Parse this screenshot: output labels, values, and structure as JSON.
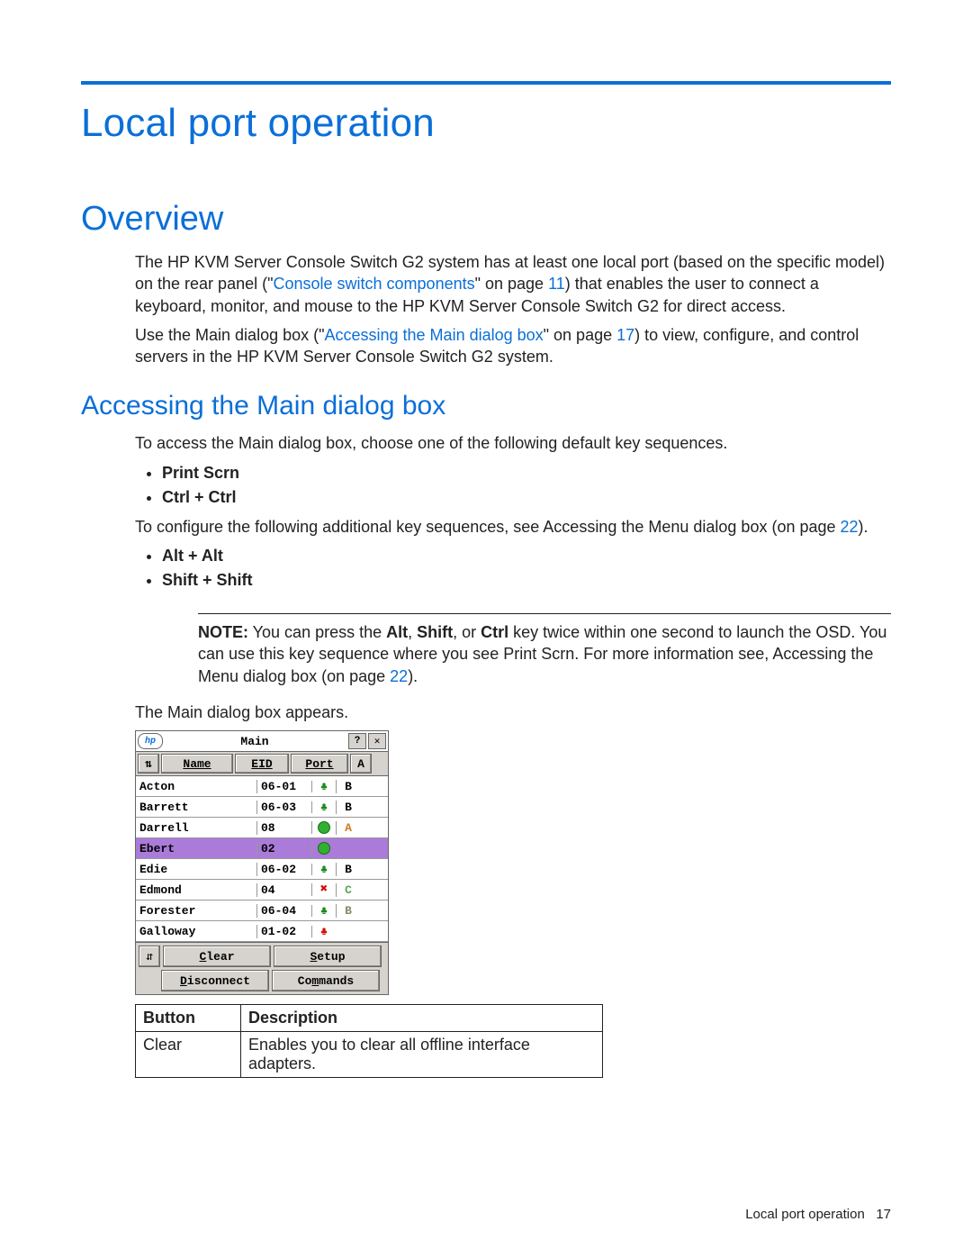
{
  "chapter_title": "Local port operation",
  "section_title": "Overview",
  "para1_a": "The HP KVM Server Console Switch G2 system has at least one local port (based on the specific model) on the rear panel (\"",
  "xref1": "Console switch components",
  "para1_b": "\" on page ",
  "pageref1": "11",
  "para1_c": ") that enables the user to connect a keyboard, monitor, and mouse to the HP KVM Server Console Switch G2 for direct access.",
  "para2_a": "Use the Main dialog box (\"",
  "xref2": "Accessing the Main dialog box",
  "para2_b": "\" on page ",
  "pageref2": "17",
  "para2_c": ") to view, configure, and control servers in the HP KVM Server Console Switch G2 system.",
  "subsection_title": "Accessing the Main dialog box",
  "para3": "To access the Main dialog box, choose one of the following default key sequences.",
  "bullets1": {
    "a": "Print Scrn",
    "b": "Ctrl + Ctrl"
  },
  "para4_a": "To configure the following additional key sequences, see Accessing the Menu dialog box (on page ",
  "pageref3": "22",
  "para4_b": ").",
  "bullets2": {
    "a": "Alt + Alt",
    "b": "Shift + Shift"
  },
  "note_label": "NOTE:",
  "note_a": "  You can press the ",
  "note_alt": "Alt",
  "note_sep1": ", ",
  "note_shift": "Shift",
  "note_sep2": ", or ",
  "note_ctrl": "Ctrl",
  "note_b": " key twice within one second to launch the OSD. You can use this key sequence where you see Print Scrn. For more information see, Accessing the Menu dialog box (on page ",
  "pageref4": "22",
  "note_c": ").",
  "para5": "The Main dialog box appears.",
  "dialog": {
    "title": "Main",
    "help_icon": "?",
    "close_icon": "✕",
    "headers": {
      "sort": "⇅",
      "name": "Name",
      "eid": "EID",
      "port": "Port",
      "a": "A"
    },
    "rows": [
      {
        "name": "Acton",
        "port": "06-01",
        "status": "tree-green",
        "b": "B",
        "bcolor": "#000",
        "selected": false
      },
      {
        "name": "Barrett",
        "port": "06-03",
        "status": "tree-green",
        "b": "B",
        "bcolor": "#000",
        "selected": false
      },
      {
        "name": "Darrell",
        "port": "08",
        "status": "circle",
        "b": "A",
        "bcolor": "#d07a20",
        "selected": false
      },
      {
        "name": "Ebert",
        "port": "02",
        "status": "circle",
        "b": "",
        "bcolor": "#000",
        "selected": true
      },
      {
        "name": "Edie",
        "port": "06-02",
        "status": "tree-green",
        "b": "B",
        "bcolor": "#000",
        "selected": false
      },
      {
        "name": "Edmond",
        "port": "04",
        "status": "x-red",
        "b": "C",
        "bcolor": "#5aa85a",
        "selected": false
      },
      {
        "name": "Forester",
        "port": "06-04",
        "status": "tree-green",
        "b": "B",
        "bcolor": "#8a8a6a",
        "selected": false
      },
      {
        "name": "Galloway",
        "port": "01-02",
        "status": "tree-red",
        "b": "",
        "bcolor": "#000",
        "selected": false
      }
    ],
    "footer": {
      "sort": "⇵",
      "clear_u": "C",
      "clear_r": "lear",
      "setup_u": "S",
      "setup_r": "etup",
      "disconnect_u": "D",
      "disconnect_r": "isconnect",
      "commands_pre": "Co",
      "commands_u": "m",
      "commands_r": "mands"
    }
  },
  "table": {
    "h1": "Button",
    "h2": "Description",
    "r1c1": "Clear",
    "r1c2": "Enables you to clear all offline interface adapters."
  },
  "footer_text": "Local port operation",
  "footer_page": "17"
}
